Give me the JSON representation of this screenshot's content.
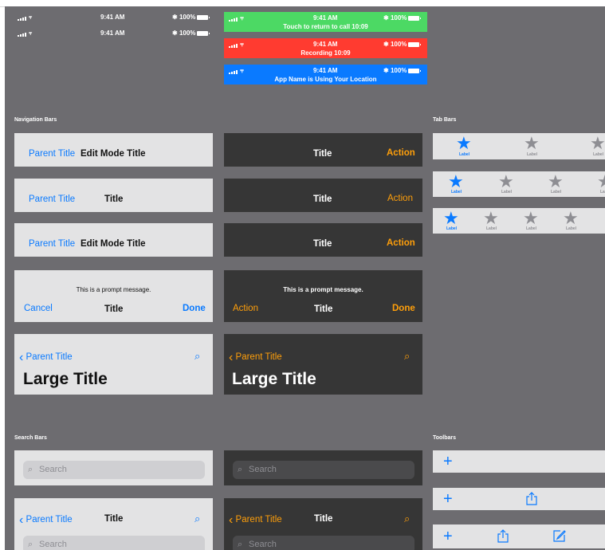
{
  "status_bar": {
    "signal": "•••",
    "time": "9:41 AM",
    "battery": "100%",
    "call_text": "Touch to return to call 10:09",
    "recording_text": "Recording 10:09",
    "location_text": "App Name is Using Your Location",
    "colors": {
      "call": "#4cd964",
      "recording": "#ff3b30",
      "location": "#0a7aff"
    }
  },
  "sections": {
    "navigation": "Navigation Bars",
    "tab": "Tab Bars",
    "search": "Search Bars",
    "toolbars": "Toolbars"
  },
  "nav": {
    "parent_title": "Parent Title",
    "edit_mode_title": "Edit Mode Title",
    "title": "Title",
    "action": "Action",
    "prompt": "This is a prompt message.",
    "cancel": "Cancel",
    "done": "Done",
    "large_title": "Large Title",
    "accent_light": "#0a7aff",
    "accent_dark": "#ff9f0a"
  },
  "tabs": {
    "label": "Label",
    "active_color": "#0a7aff",
    "inactive_color": "#8e8e93"
  },
  "search": {
    "placeholder": "Search"
  },
  "icons": [
    "search-icon",
    "chevron-left-icon",
    "star-icon",
    "plus-icon",
    "share-icon",
    "compose-icon",
    "wifi-icon",
    "bluetooth-icon",
    "battery-icon"
  ]
}
